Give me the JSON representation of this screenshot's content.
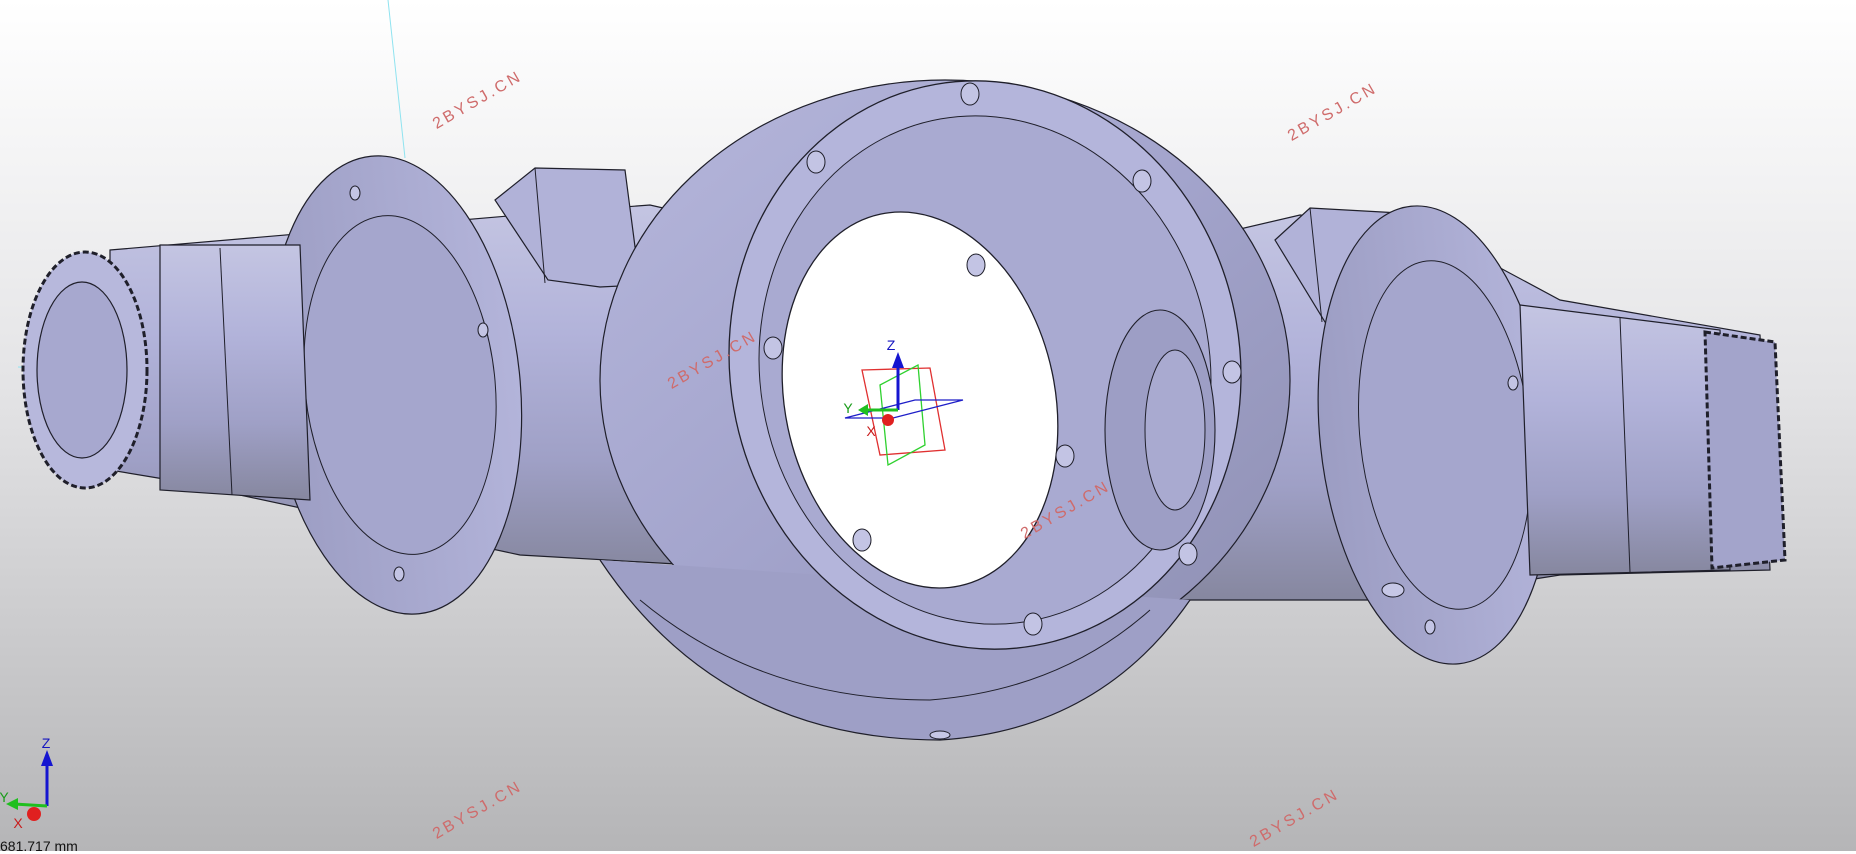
{
  "viewport": {
    "watermark_text": "2BYSJ.CN",
    "scale_readout": "681.717 mm",
    "model_color": "#a7a9cf",
    "background_top": "#ffffff",
    "background_bottom": "#b5b5b7"
  },
  "origin_triad": {
    "z_label": "Z",
    "y_label": "Y",
    "x_label": "X"
  },
  "corner_triad": {
    "z_label": "Z",
    "y_label": "Y",
    "x_label": "X"
  }
}
